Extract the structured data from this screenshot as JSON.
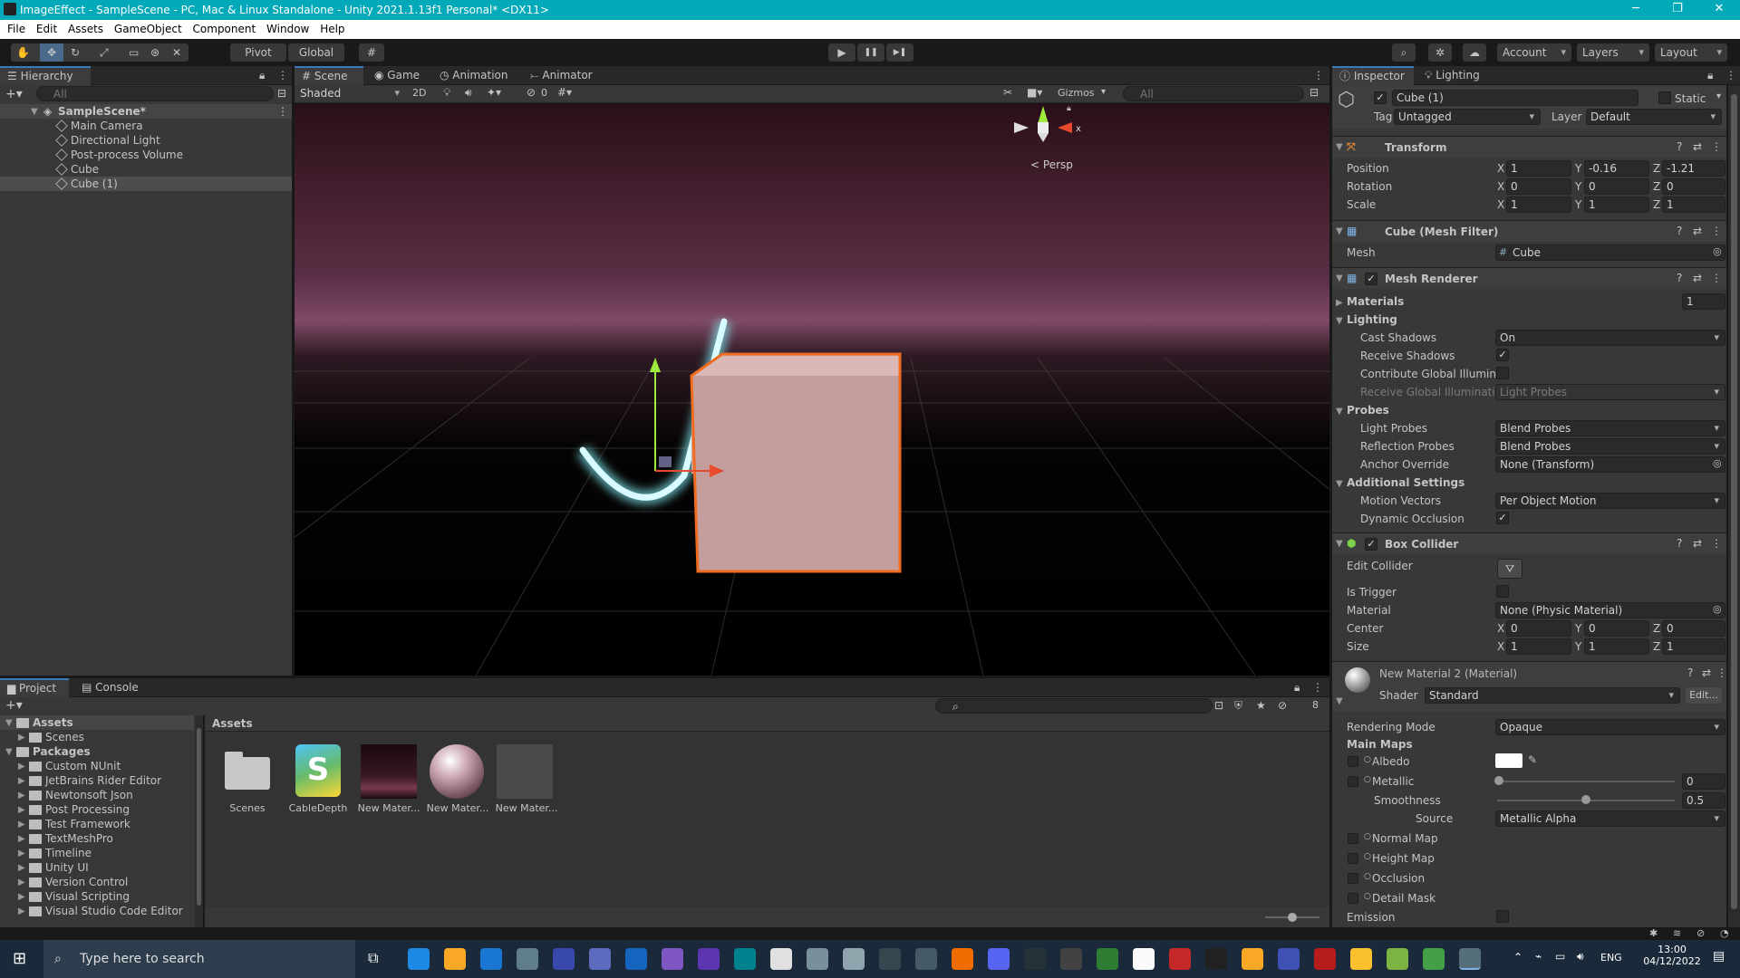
{
  "window": {
    "title": "ImageEffect - SampleScene - PC, Mac & Linux Standalone - Unity 2021.1.13f1 Personal* <DX11>",
    "minimize": "─",
    "maximize": "❐",
    "close": "✕"
  },
  "menu": [
    "File",
    "Edit",
    "Assets",
    "GameObject",
    "Component",
    "Window",
    "Help"
  ],
  "toolbar": {
    "pivot": "Pivot",
    "global": "Global",
    "account": "Account",
    "layers": "Layers",
    "layout": "Layout",
    "play": "▶",
    "pause": "❚❚",
    "step": "▶❚"
  },
  "hierarchy": {
    "tab": "Hierarchy",
    "search_placeholder": "All",
    "scene": "SampleScene*",
    "items": [
      "Main Camera",
      "Directional Light",
      "Post-process Volume",
      "Cube",
      "Cube (1)"
    ]
  },
  "scene": {
    "tabs": [
      "Scene",
      "Game",
      "Animation",
      "Animator"
    ],
    "shading": "Shaded",
    "mode2d": "2D",
    "hidden_count": "0",
    "gizmos": "Gizmos",
    "search_placeholder": "All",
    "persp": "Persp",
    "axis_x": "x",
    "axis_y": "y"
  },
  "inspector": {
    "tabs": [
      "Inspector",
      "Lighting"
    ],
    "object_name": "Cube (1)",
    "static_label": "Static",
    "tag_label": "Tag",
    "tag_value": "Untagged",
    "layer_label": "Layer",
    "layer_value": "Default",
    "transform": {
      "title": "Transform",
      "rows": [
        {
          "label": "Position",
          "x": "1",
          "y": "-0.16",
          "z": "-1.21"
        },
        {
          "label": "Rotation",
          "x": "0",
          "y": "0",
          "z": "0"
        },
        {
          "label": "Scale",
          "x": "1",
          "y": "1",
          "z": "1"
        }
      ]
    },
    "mesh_filter": {
      "title": "Cube (Mesh Filter)",
      "mesh_label": "Mesh",
      "mesh_value": "Cube"
    },
    "mesh_renderer": {
      "title": "Mesh Renderer",
      "materials_label": "Materials",
      "materials_count": "1",
      "lighting_label": "Lighting",
      "cast_shadows_label": "Cast Shadows",
      "cast_shadows": "On",
      "receive_shadows_label": "Receive Shadows",
      "contribute_gi_label": "Contribute Global Illuminat",
      "receive_gi_label": "Receive Global Illuminatior",
      "receive_gi": "Light Probes",
      "probes_label": "Probes",
      "light_probes_label": "Light Probes",
      "light_probes": "Blend Probes",
      "reflection_probes_label": "Reflection Probes",
      "reflection_probes": "Blend Probes",
      "anchor_label": "Anchor Override",
      "anchor": "None (Transform)",
      "additional_label": "Additional Settings",
      "motion_vectors_label": "Motion Vectors",
      "motion_vectors": "Per Object Motion",
      "dynamic_occlusion_label": "Dynamic Occlusion"
    },
    "box_collider": {
      "title": "Box Collider",
      "edit_collider": "Edit Collider",
      "is_trigger": "Is Trigger",
      "material_label": "Material",
      "material": "None (Physic Material)",
      "center_label": "Center",
      "center": {
        "x": "0",
        "y": "0",
        "z": "0"
      },
      "size_label": "Size",
      "size": {
        "x": "1",
        "y": "1",
        "z": "1"
      }
    },
    "material": {
      "title": "New Material 2 (Material)",
      "shader_label": "Shader",
      "shader": "Standard",
      "edit": "Edit...",
      "rendering_mode_label": "Rendering Mode",
      "rendering_mode": "Opaque",
      "main_maps": "Main Maps",
      "albedo": "Albedo",
      "metallic": "Metallic",
      "metallic_value": "0",
      "smoothness": "Smoothness",
      "smoothness_value": "0.5",
      "source": "Source",
      "source_value": "Metallic Alpha",
      "normal_map": "Normal Map",
      "height_map": "Height Map",
      "occlusion": "Occlusion",
      "detail_mask": "Detail Mask",
      "emission": "Emission"
    }
  },
  "project": {
    "tabs": [
      "Project",
      "Console"
    ],
    "hidden_count": "8",
    "breadcrumb": "Assets",
    "tree": [
      {
        "label": "Assets",
        "level": 0
      },
      {
        "label": "Scenes",
        "level": 1
      },
      {
        "label": "Packages",
        "level": 0
      },
      {
        "label": "Custom NUnit",
        "level": 1
      },
      {
        "label": "JetBrains Rider Editor",
        "level": 1
      },
      {
        "label": "Newtonsoft Json",
        "level": 1
      },
      {
        "label": "Post Processing",
        "level": 1
      },
      {
        "label": "Test Framework",
        "level": 1
      },
      {
        "label": "TextMeshPro",
        "level": 1
      },
      {
        "label": "Timeline",
        "level": 1
      },
      {
        "label": "Unity UI",
        "level": 1
      },
      {
        "label": "Version Control",
        "level": 1
      },
      {
        "label": "Visual Scripting",
        "level": 1
      },
      {
        "label": "Visual Studio Code Editor",
        "level": 1
      }
    ],
    "assets": [
      "Scenes",
      "CableDepth",
      "New Mater...",
      "New Mater...",
      "New Mater..."
    ],
    "cable_glyph": "S"
  },
  "taskbar": {
    "search_placeholder": "Type here to search",
    "lang": "ENG",
    "time": "13:00",
    "date": "04/12/2022"
  },
  "colors": {
    "accent": "#3a79bb",
    "title_bar": "#02a9b8",
    "selection_outline": "#f26c1f",
    "glow": "#7fe8ee"
  }
}
